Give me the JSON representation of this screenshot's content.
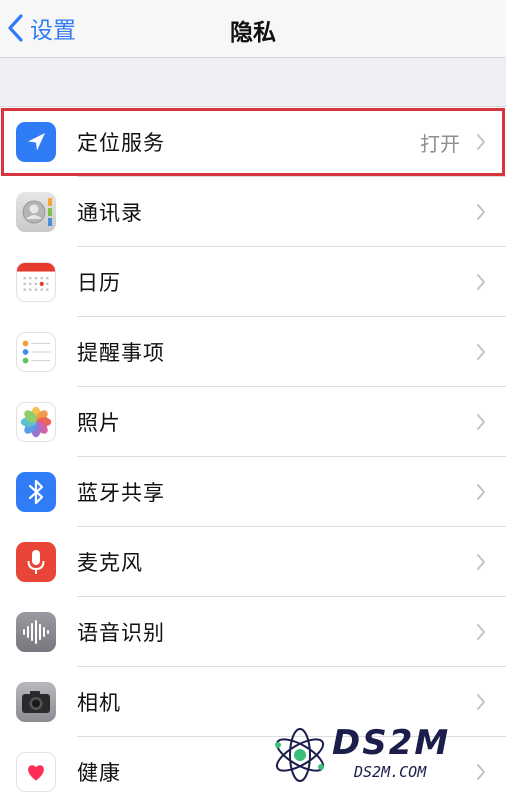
{
  "nav": {
    "back_label": "设置",
    "title": "隐私"
  },
  "rows": [
    {
      "label": "定位服务",
      "value": "打开",
      "icon": "location-arrow-icon",
      "color": "#2f7cf6"
    },
    {
      "label": "通讯录",
      "icon": "contacts-icon",
      "color": "#d6d6d6"
    },
    {
      "label": "日历",
      "icon": "calendar-icon",
      "color": "#e63a2e"
    },
    {
      "label": "提醒事项",
      "icon": "reminders-icon",
      "color": "#ffffff"
    },
    {
      "label": "照片",
      "icon": "photos-icon",
      "color": "#ffffff"
    },
    {
      "label": "蓝牙共享",
      "icon": "bluetooth-icon",
      "color": "#2f7cf6"
    },
    {
      "label": "麦克风",
      "icon": "microphone-icon",
      "color": "#e84437"
    },
    {
      "label": "语音识别",
      "icon": "speech-waveform-icon",
      "color": "#8e8e93"
    },
    {
      "label": "相机",
      "icon": "camera-icon",
      "color": "#8e8e93"
    },
    {
      "label": "健康",
      "icon": "heart-icon",
      "color": "#ff2d55"
    }
  ],
  "highlight": {
    "row": "定位服务",
    "color": "#d9343c"
  },
  "watermark": {
    "big": "DS2M",
    "small": "DS2M.COM"
  }
}
